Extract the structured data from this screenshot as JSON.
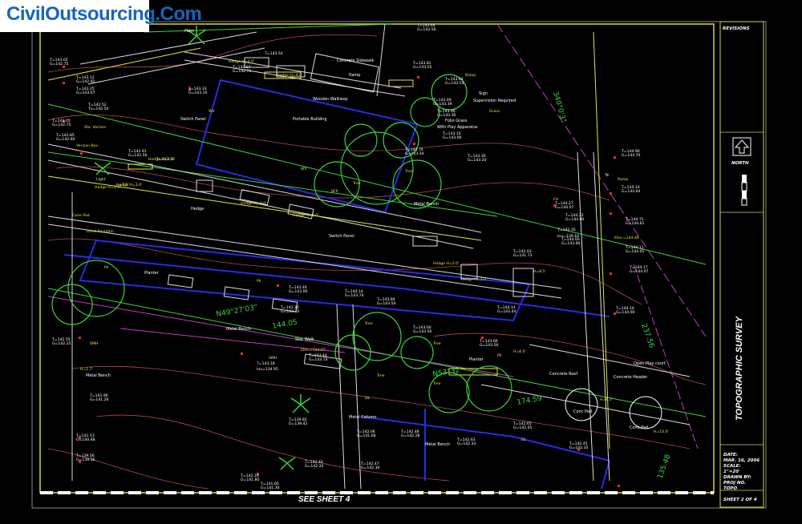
{
  "logo": {
    "text": "CivilOutsourcing.Com"
  },
  "title_block": {
    "revisions_label": "REVISIONS",
    "north_label": "NORTH",
    "title": "TOPOGRAPHIC SURVEY",
    "date_label": "DATE:",
    "date_value": "MAR. 16, 2006",
    "scale_label": "SCALE:",
    "scale_value": "1\"=20'",
    "drawn_label": "DRAWN BY:",
    "proj_label": "PROJ NO.",
    "proj_value": "TOPO",
    "sheet": "SHEET 2 OF 4"
  },
  "match_line": "SEE SHEET 4",
  "site_labels": {
    "wooden_walkway": "Wooden Walkway",
    "portable_building": "Portable Building",
    "concrete_sidewalk": "Concrete Sidewalk",
    "ramp": "Ramp",
    "switch_panel": "Switch Panel",
    "switch_panel2": "Switch Panel",
    "metal_bench": "Metal Bench",
    "metal_bench2": "Metal Bench",
    "metal_bench3": "Metal Bench",
    "metal_bench4": "Metal Bench",
    "concrete_roof": "Concrete Roof",
    "concrete_header": "Concrete Header",
    "open_play_court": "Open Play court",
    "conc_pad": "Conc Pad",
    "conc_pad2": "Conc Pad",
    "planter": "Planter",
    "planter2": "Planter",
    "hedge": "Hedge",
    "sign": "Sign",
    "sign_text": "Supervision Required",
    "folio_grass": "Folio Grass",
    "play_apparatus": "With Play Apparatus",
    "metal_column": "Metal Column",
    "stw_walk": "Stw. Walk",
    "north_marker": "N",
    "palm": "Palm"
  },
  "bearings": [
    {
      "text": "N49°27'03\""
    },
    {
      "text": "144.05"
    },
    {
      "text": "N53°32'"
    },
    {
      "text": "174.59"
    },
    {
      "text": "340°0'3\""
    },
    {
      "text": "237.56"
    },
    {
      "text": "135.48"
    }
  ],
  "spot_elevations": [
    "T=143.02",
    "G=142.75",
    "T=143.12",
    "G=142.92",
    "T=143.25",
    "G=143.07",
    "T=142.52",
    "Tv=140.54",
    "T=143.05",
    "G=142.75",
    "T=142.85",
    "G=142.60",
    "T=142.91",
    "G=142.56",
    "T=143.10",
    "T=143.33",
    "G=143.10",
    "T=142.97",
    "G=142.71",
    "T=143.54",
    "T=143.64",
    "G=143.58",
    "T=143.81",
    "G=143.55",
    "T=143.64",
    "G=143.54",
    "T=143.49",
    "G=143.39",
    "T=143.46",
    "G=143.36",
    "T=143.10",
    "G=143.00",
    "T=143.74",
    "G=143.34",
    "T=143.30",
    "G=143.20",
    "T=144.90",
    "G=144.70",
    "T=145.14",
    "G=144.64",
    "T=144.27",
    "G=144.07",
    "T=144.22",
    "G=144.00",
    "T=144.71",
    "G=144.61",
    "T=142.16",
    "Inv=139.44",
    "T=144.00",
    "G=143.90",
    "T=144.11",
    "G=144.01",
    "T=142.03",
    "G=141.73",
    "T=144.17",
    "G=144.07",
    "T=144.14",
    "G=143.44",
    "T=144.10",
    "G=144.00",
    "T=143.60",
    "G=143.50",
    "T=143.66",
    "G=143.56",
    "T=142.55",
    "G=142.25",
    "T=141.96",
    "G=141.26",
    "T=141.13",
    "G=140.48",
    "T=139.56",
    "G=139.56",
    "T=139.82",
    "G=139.42",
    "T=142.06",
    "G=141.68",
    "T=142.48",
    "G=142.28",
    "T=142.63",
    "G=142.33",
    "T=142.65",
    "G=142.45",
    "T=142.45",
    "G=142.35",
    "T=142.47",
    "G=142.30",
    "T=142.10",
    "G=141.80",
    "T=141.60",
    "G=141.30",
    "T=142.40",
    "G=142.20",
    "T=144.14",
    "G=143.74",
    "T=143.84",
    "G=143.54",
    "T=143.18",
    "Inv=134.95",
    "T=143.44",
    "G=143.14",
    "T=143.30",
    "G=143.10",
    "T=143.40",
    "G=143.00"
  ],
  "small_notes": [
    "Hedge H=4.0'",
    "Hedge H=4.0'",
    "Hedge H=3.0'",
    "Hedge H=3.0'",
    "Hedge H=3.0'",
    "Hedge H=3.0'",
    "Hedge H=3.5'",
    "Hedge H=2.0'",
    "Hedge H=3.0'",
    "Tree",
    "Tree",
    "Tree",
    "Tree",
    "Tree",
    "Tree",
    "BFP",
    "WV",
    "WV",
    "FH",
    "DL",
    "DL",
    "SMH",
    "SMH",
    "Sta. Verizon",
    "Verizon Box",
    "Light",
    "Ramp",
    "Ramp",
    "Plr",
    "Plr",
    "Plr",
    "Cone Pod",
    "Drink Fountain",
    "Elev.=144.48",
    "Elev.=143.07",
    "H=3.5'",
    "H=8.5'",
    "H=1.7'",
    "H=10.0'",
    "H=6.3'",
    "H=6.0'",
    "Grass"
  ],
  "colors": {
    "background": "#000000",
    "frame": "#d6d64a",
    "building": "#2a2ae6",
    "text": "#ffffff",
    "topo": "#b84a4a",
    "green": "#39d439",
    "yellow": "#e6e63c",
    "magenta": "#c43cc4",
    "red": "#ff2a2a",
    "cyan": "#4ad6d6"
  }
}
